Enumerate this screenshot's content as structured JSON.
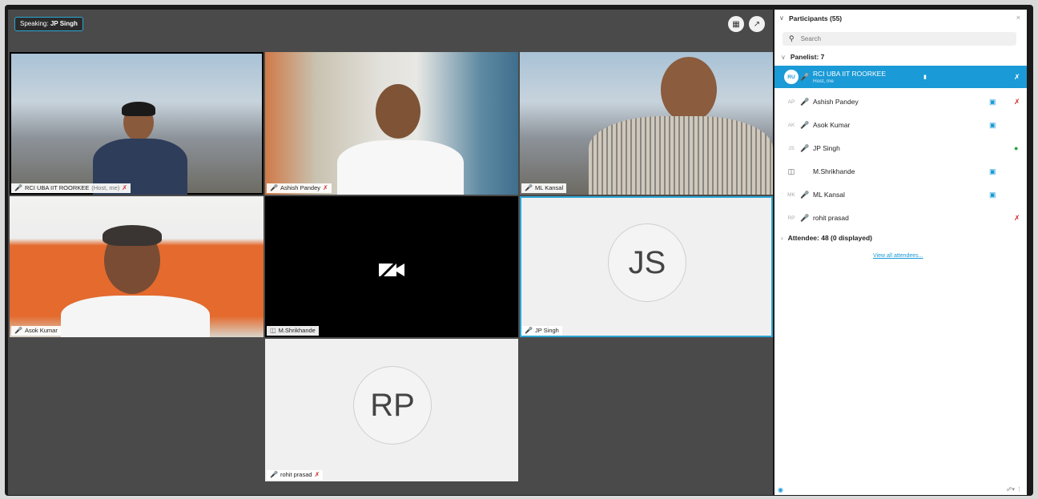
{
  "speaking": {
    "prefix": "Speaking:",
    "name": "JP Singh"
  },
  "view_buttons": {
    "grid_icon": "grid-icon",
    "popout_icon": "popout-icon"
  },
  "tiles": [
    {
      "label": "RCI UBA IIT ROORKEE",
      "host": "(Host, me)"
    },
    {
      "label": "Ashish Pandey"
    },
    {
      "label": "ML Kansal"
    },
    {
      "label": "Asok Kumar"
    },
    {
      "label": "M.Shrikhande"
    },
    {
      "label": "JP Singh",
      "initials": "JS"
    },
    {
      "label": "rohit prasad",
      "initials": "RP"
    }
  ],
  "panel": {
    "title": "Participants (55)",
    "search_placeholder": "Search",
    "panelist_header": "Panelist: 7",
    "attendee_header": "Attendee: 48 (0 displayed)",
    "view_all": "View all attendees...",
    "participants": [
      {
        "initials": "RU",
        "name": "RCI UBA IIT ROORKEE",
        "sub": "Host, me"
      },
      {
        "initials": "AP",
        "name": "Ashish Pandey"
      },
      {
        "initials": "AK",
        "name": "Asok Kumar"
      },
      {
        "initials": "JS",
        "name": "JP Singh"
      },
      {
        "initials": "",
        "name": "M.Shrikhande"
      },
      {
        "initials": "MK",
        "name": "ML Kansal"
      },
      {
        "initials": "RP",
        "name": "rohit prasad"
      }
    ]
  },
  "colors": {
    "accent": "#1a9ad6",
    "muted": "#d0302c",
    "stage": "#4a4a4a"
  }
}
